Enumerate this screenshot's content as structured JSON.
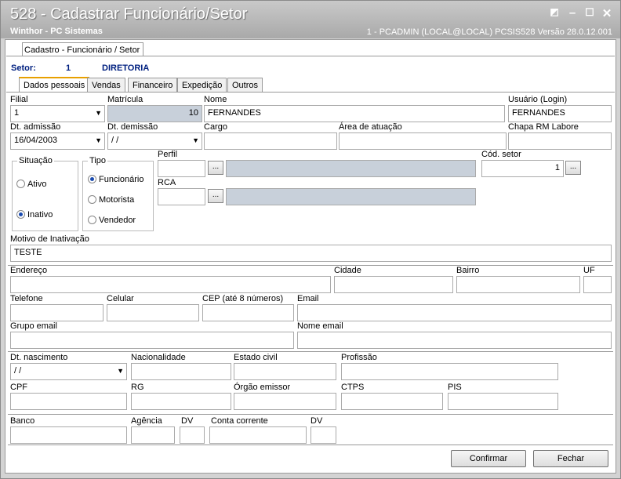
{
  "window": {
    "title": "528 - Cadastrar Funcionário/Setor",
    "company": "Winthor - PC Sistemas",
    "info": "1 - PCADMIN (LOCAL@LOCAL)   PCSIS528  Versão  28.0.12.001"
  },
  "top_tab": "Cadastro - Funcionário / Setor",
  "setor": {
    "label": "Setor:",
    "code": "1",
    "name": "DIRETORIA"
  },
  "tabs": [
    "Dados pessoais",
    "Vendas",
    "Financeiro",
    "Expedição",
    "Outros"
  ],
  "fields": {
    "filial": {
      "label": "Filial",
      "value": "1"
    },
    "matricula": {
      "label": "Matrícula",
      "value": "10"
    },
    "nome": {
      "label": "Nome",
      "value": "FERNANDES"
    },
    "usuario": {
      "label": "Usuário (Login)",
      "value": "FERNANDES"
    },
    "dt_admissao": {
      "label": "Dt. admissão",
      "value": "16/04/2003"
    },
    "dt_demissao": {
      "label": "Dt.  demissão",
      "value": " /  /"
    },
    "cargo": {
      "label": "Cargo",
      "value": ""
    },
    "area": {
      "label": "Área de atuação",
      "value": ""
    },
    "chapa": {
      "label": "Chapa RM Labore",
      "value": ""
    },
    "perfil": {
      "label": "Perfil",
      "value": ""
    },
    "cod_setor": {
      "label": "Cód. setor",
      "value": "1"
    },
    "rca": {
      "label": "RCA",
      "value": ""
    },
    "motivo": {
      "label": "Motivo de Inativação",
      "value": "TESTE"
    },
    "endereco": {
      "label": "Endereço",
      "value": ""
    },
    "cidade": {
      "label": "Cidade",
      "value": ""
    },
    "bairro": {
      "label": "Bairro",
      "value": ""
    },
    "uf": {
      "label": "UF",
      "value": ""
    },
    "telefone": {
      "label": "Telefone",
      "value": ""
    },
    "celular": {
      "label": "Celular",
      "value": ""
    },
    "cep": {
      "label": "CEP (até 8 números)",
      "value": ""
    },
    "email": {
      "label": "Email",
      "value": ""
    },
    "grupo_email": {
      "label": "Grupo email",
      "value": ""
    },
    "nome_email": {
      "label": "Nome email",
      "value": ""
    },
    "dt_nascimento": {
      "label": "Dt. nascimento",
      "value": " /  /"
    },
    "nacionalidade": {
      "label": "Nacionalidade",
      "value": ""
    },
    "estado_civil": {
      "label": "Estado civil",
      "value": ""
    },
    "profissao": {
      "label": "Profissão",
      "value": ""
    },
    "cpf": {
      "label": "CPF",
      "value": ""
    },
    "rg": {
      "label": "RG",
      "value": ""
    },
    "orgao": {
      "label": "Órgão emissor",
      "value": ""
    },
    "ctps": {
      "label": "CTPS",
      "value": ""
    },
    "pis": {
      "label": "PIS",
      "value": ""
    },
    "banco": {
      "label": "Banco",
      "value": ""
    },
    "agencia": {
      "label": "Agência",
      "value": ""
    },
    "dv1": {
      "label": "DV",
      "value": ""
    },
    "conta": {
      "label": "Conta corrente",
      "value": ""
    },
    "dv2": {
      "label": "DV",
      "value": ""
    }
  },
  "situacao": {
    "label": "Situação",
    "options": [
      "Ativo",
      "Inativo"
    ],
    "selected": "Inativo"
  },
  "tipo": {
    "label": "Tipo",
    "options": [
      "Funcionário",
      "Motorista",
      "Vendedor"
    ],
    "selected": "Funcionário"
  },
  "buttons": {
    "dots": "...",
    "confirmar": "Confirmar",
    "fechar": "Fechar"
  }
}
